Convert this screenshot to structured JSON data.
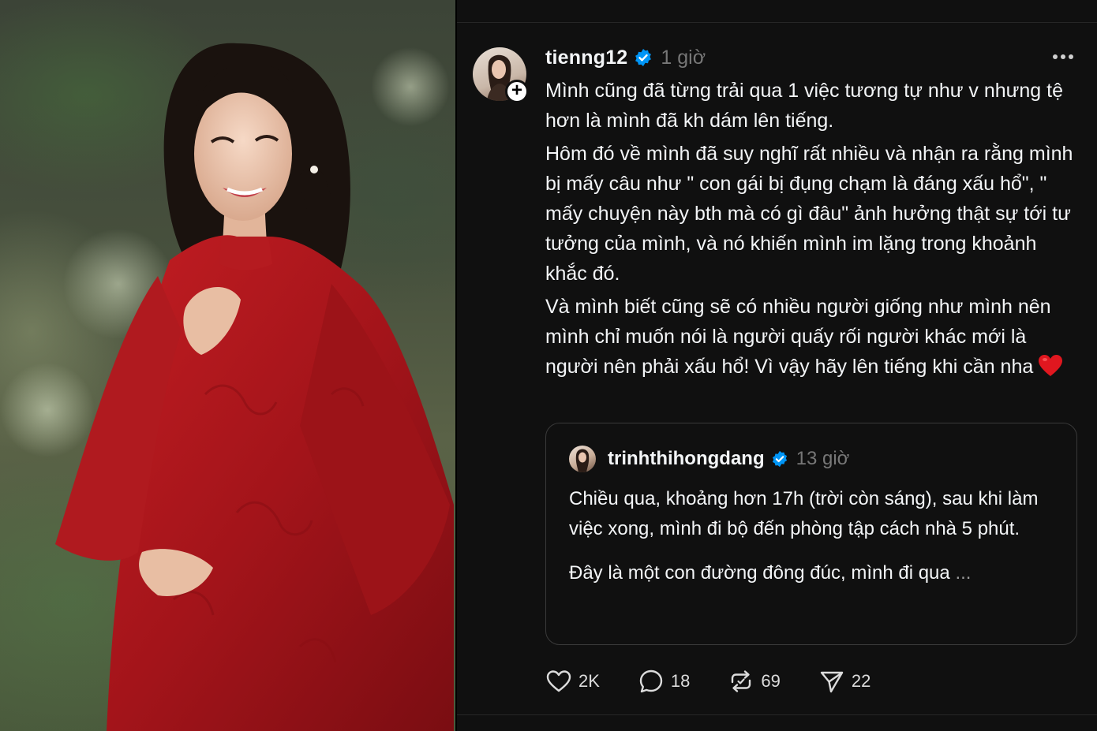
{
  "post": {
    "author": "tienng12",
    "time": "1 giờ",
    "paragraphs": [
      "Mình cũng đã từng trải qua 1 việc tương tự như v nhưng tệ hơn là mình đã kh dám lên tiếng.",
      "Hôm đó về mình đã suy nghĩ rất nhiều và nhận ra rằng mình bị mấy câu như \" con gái bị đụng chạm là đáng xấu hổ\", \" mấy chuyện này bth mà có gì đâu\" ảnh hưởng thật sự tới tư tưởng của mình, và nó khiến mình im lặng trong khoảnh khắc đó.",
      "Và mình biết cũng sẽ có nhiều người giống như mình nên mình chỉ muốn nói là người quấy rối người khác mới là người nên phải xấu hổ! Vì vậy hãy lên tiếng khi cần nha"
    ],
    "heart_emoji_icon": "red-heart-emoji"
  },
  "quote": {
    "author": "trinhthihongdang",
    "time": "13 giờ",
    "paragraph1": "Chiều qua, khoảng hơn 17h (trời còn sáng), sau khi làm việc xong, mình đi bộ đến phòng tập cách nhà 5 phút.",
    "paragraph2": "Đây là một con đường đông đúc, mình đi qua",
    "ellipsis": "..."
  },
  "actions": {
    "likes": "2K",
    "comments": "18",
    "reposts": "69",
    "shares": "22"
  },
  "colors": {
    "background": "#101010",
    "text": "#f3f5f7",
    "muted": "#777777",
    "verified": "#0095f6",
    "heart": "#e0171f",
    "dress": "#a3141a"
  }
}
